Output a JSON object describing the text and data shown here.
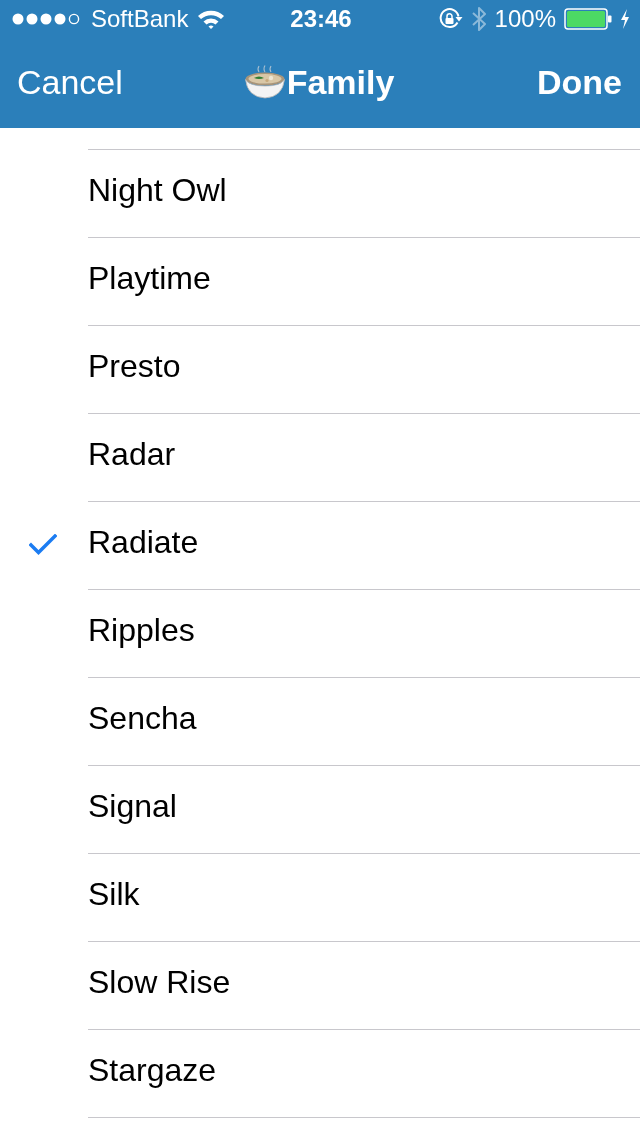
{
  "status_bar": {
    "carrier": "SoftBank",
    "time": "23:46",
    "battery": "100%"
  },
  "nav_bar": {
    "cancel": "Cancel",
    "title": "Family",
    "done": "Done"
  },
  "list": {
    "items": [
      {
        "label": "Night Owl",
        "selected": false
      },
      {
        "label": "Playtime",
        "selected": false
      },
      {
        "label": "Presto",
        "selected": false
      },
      {
        "label": "Radar",
        "selected": false
      },
      {
        "label": "Radiate",
        "selected": true
      },
      {
        "label": "Ripples",
        "selected": false
      },
      {
        "label": "Sencha",
        "selected": false
      },
      {
        "label": "Signal",
        "selected": false
      },
      {
        "label": "Silk",
        "selected": false
      },
      {
        "label": "Slow Rise",
        "selected": false
      },
      {
        "label": "Stargaze",
        "selected": false
      }
    ]
  }
}
